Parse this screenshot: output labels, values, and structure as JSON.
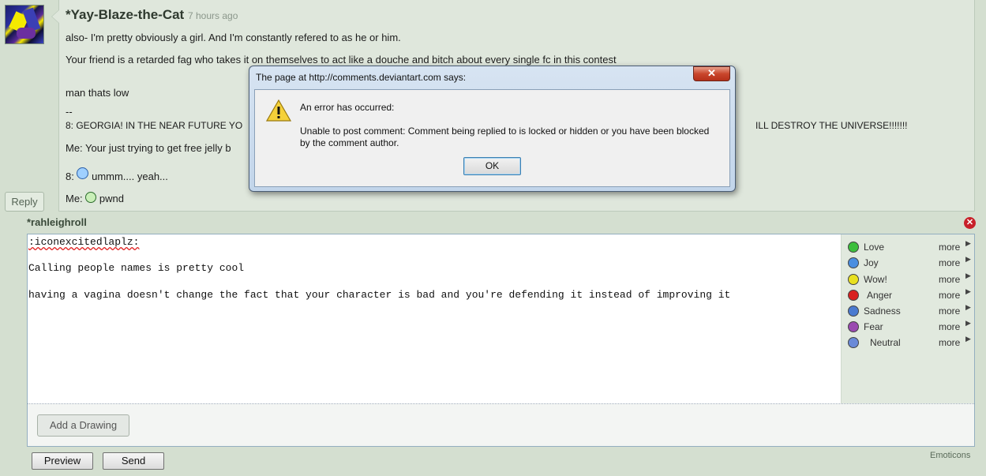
{
  "comment": {
    "author": "*Yay-Blaze-the-Cat",
    "timestamp": "7 hours ago",
    "lines": {
      "l1": "also- I'm pretty obviously a girl. And I'm constantly refered to as he or him.",
      "l2": "Your friend is a retarded fag who takes it on themselves to act like a douche and bitch about every single fc in this contest",
      "l3": "man thats low",
      "l4": "--",
      "l5a": "8: GEORGIA! IN THE NEAR FUTURE YO",
      "l5b": "ILL DESTROY THE UNIVERSE!!!!!!!",
      "l6": "Me: Your just trying to get free jelly b",
      "l7_prefix": "8:",
      "l7_text": "ummm.... yeah...",
      "l8_prefix": "Me:",
      "l8_text": "pwnd"
    },
    "reply_label": "Reply"
  },
  "reply_form": {
    "replier": "*rahleighroll",
    "close_symbol": "✕",
    "text": {
      "line1": ":iconexcitedlaplz:",
      "line2": "Calling people names is pretty cool",
      "line3": "having a vagina doesn't change the fact that your character is bad and you're defending it instead of improving it"
    },
    "emoticons": [
      {
        "label": "Love",
        "more": "more",
        "color": "#3cbf3c"
      },
      {
        "label": "Joy",
        "more": "more",
        "color": "#4a8ee0"
      },
      {
        "label": "Wow!",
        "more": "more",
        "color": "#e8e020"
      },
      {
        "label": "Anger",
        "more": "more",
        "color": "#d82020"
      },
      {
        "label": "Sadness",
        "more": "more",
        "color": "#4a7ad0"
      },
      {
        "label": "Fear",
        "more": "more",
        "color": "#9a4ab0"
      },
      {
        "label": "Neutral",
        "more": "more",
        "color": "#6a8ad8"
      }
    ],
    "add_drawing": "Add a Drawing",
    "preview": "Preview",
    "send": "Send",
    "emoticons_link": "Emoticons"
  },
  "dialog": {
    "title": "The page at http://comments.deviantart.com says:",
    "close": "✕",
    "message1": "An error has occurred:",
    "message2": "Unable to post comment: Comment being replied to is locked or hidden or you have been blocked by the comment author.",
    "ok": "OK"
  }
}
